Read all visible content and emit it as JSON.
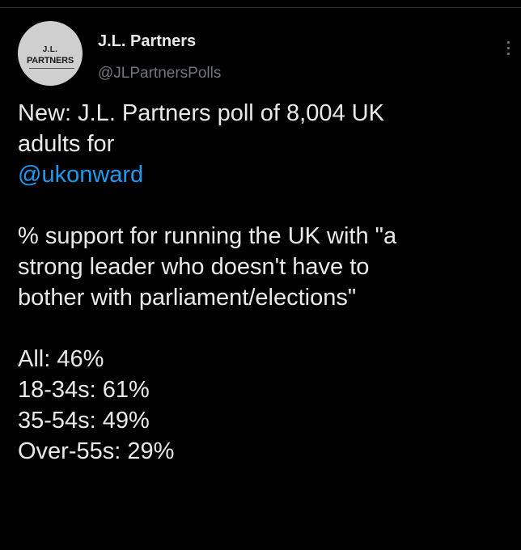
{
  "author": {
    "display_name": "J.L. Partners",
    "handle": "@JLPartnersPolls",
    "avatar_text_line1": "J.L.",
    "avatar_text_line2": "PARTNERS"
  },
  "tweet": {
    "line1": "New: J.L. Partners poll of 8,004 UK",
    "line2": "adults for",
    "mention": "@ukonward",
    "line3": "% support for running the UK with \"a",
    "line4": "strong leader who doesn't have to",
    "line5": "bother with parliament/elections\"",
    "stats": [
      "All: 46%",
      "18-34s: 61%",
      "35-54s: 49%",
      "Over-55s: 29%"
    ]
  },
  "icons": {
    "more": "more-options-icon"
  },
  "colors": {
    "background": "#000000",
    "text": "#e7e9ea",
    "secondary_text": "#71767b",
    "link": "#1d9bf0",
    "divider": "#2f3336"
  }
}
